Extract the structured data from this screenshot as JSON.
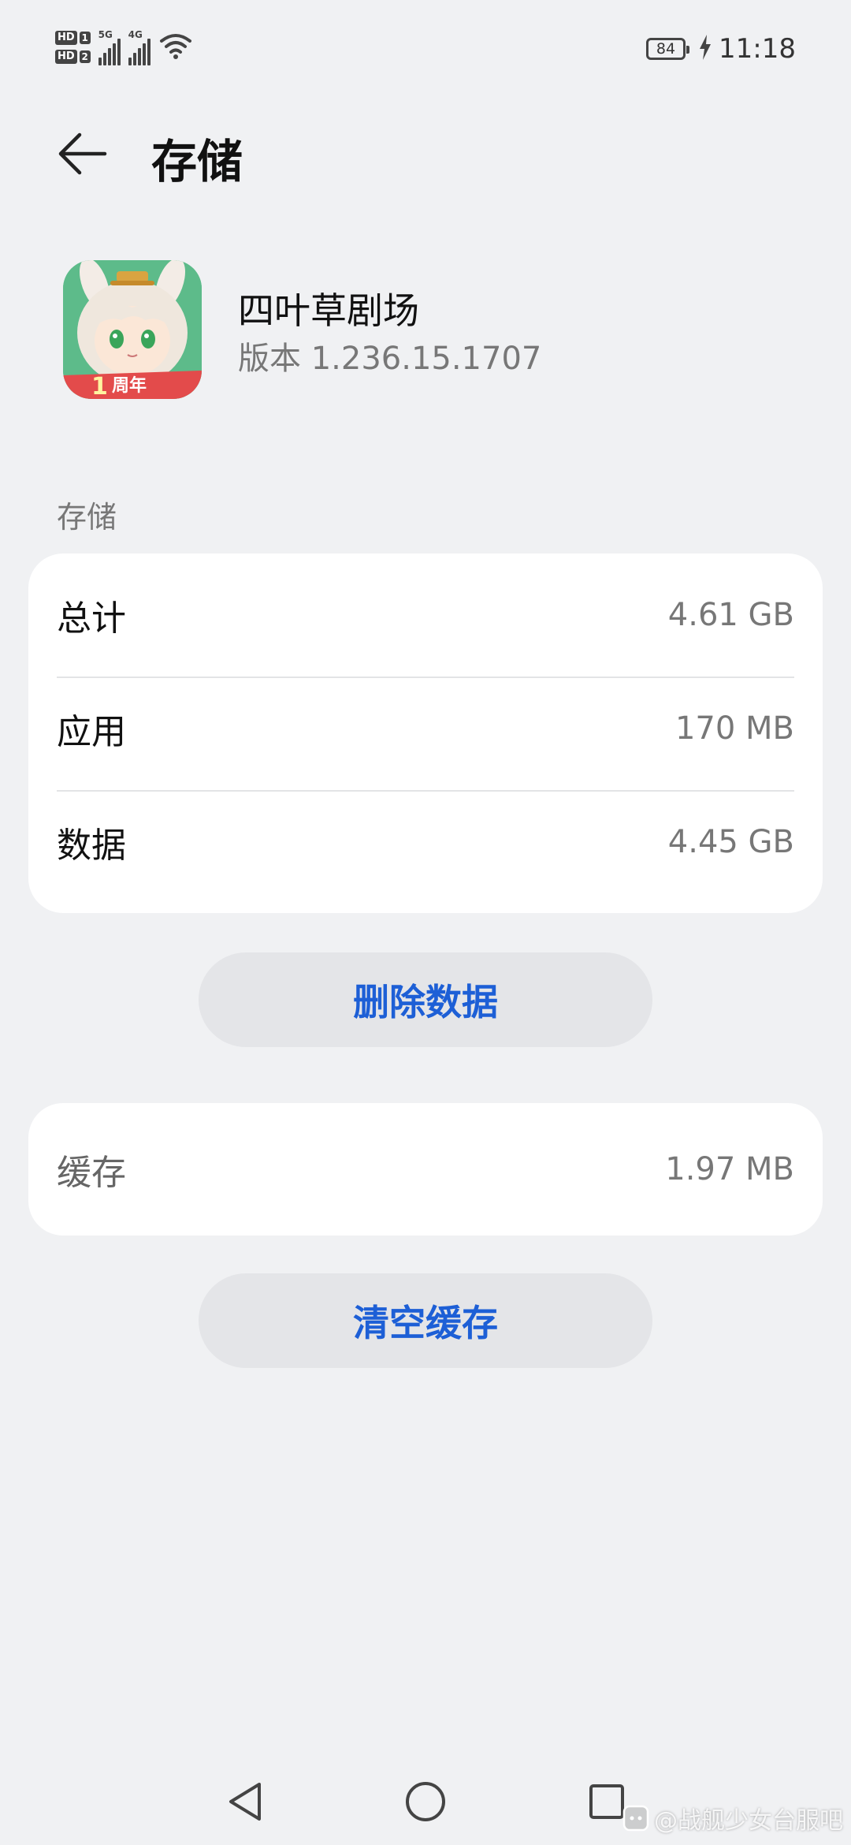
{
  "status_bar": {
    "sim1_label": "HD",
    "sim1_num": "1",
    "sim2_label": "HD",
    "sim2_num": "2",
    "net1": "5G",
    "net2": "4G",
    "battery_level": "84",
    "time": "11:18",
    "icons": [
      "signal-icon",
      "wifi-icon",
      "battery-icon",
      "charging-bolt-icon"
    ]
  },
  "header": {
    "title": "存储",
    "back_icon": "arrow-left-icon"
  },
  "app": {
    "name": "四叶草剧场",
    "version": "版本 1.236.15.1707",
    "icon_badge": "周年",
    "icon_badge_num": "1"
  },
  "storage_section": {
    "label": "存储",
    "rows": [
      {
        "label": "总计",
        "value": "4.61 GB"
      },
      {
        "label": "应用",
        "value": "170 MB"
      },
      {
        "label": "数据",
        "value": "4.45 GB"
      }
    ],
    "delete_button": "删除数据"
  },
  "cache_section": {
    "label": "缓存",
    "value": "1.97 MB",
    "clear_button": "清空缓存"
  },
  "nav_bar": {
    "icons": [
      "nav-back-icon",
      "nav-home-icon",
      "nav-recent-icon"
    ]
  },
  "watermark": {
    "text": "@战舰少女台服吧"
  },
  "colors": {
    "background": "#f0f1f3",
    "accent": "#1d5fd6",
    "card": "#ffffff"
  }
}
